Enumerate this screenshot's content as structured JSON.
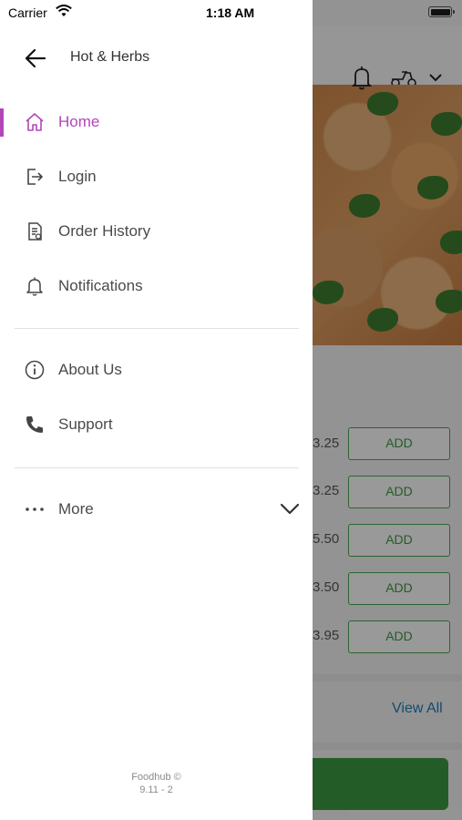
{
  "status_bar": {
    "carrier": "Carrier",
    "time": "1:18 AM"
  },
  "drawer": {
    "store_name": "Hot & Herbs",
    "menu_items": [
      {
        "label": "Home",
        "icon": "home-icon",
        "active": true
      },
      {
        "label": "Login",
        "icon": "login-icon"
      },
      {
        "label": "Order History",
        "icon": "order-history-icon"
      },
      {
        "label": "Notifications",
        "icon": "bell-icon"
      },
      {
        "label": "About Us",
        "icon": "info-icon"
      },
      {
        "label": "Support",
        "icon": "phone-icon"
      },
      {
        "label": "More",
        "icon": "more-dots-icon"
      }
    ],
    "footer": {
      "brand": "Foodhub ©",
      "version": "9.11 - 2"
    }
  },
  "background": {
    "prices": [
      "3.25",
      "3.25",
      "5.50",
      "3.50",
      "3.95"
    ],
    "add_label": "ADD",
    "view_all": "View All"
  },
  "colors": {
    "accent": "#b147b7",
    "green": "#3d9a44",
    "link": "#1f7db5"
  }
}
